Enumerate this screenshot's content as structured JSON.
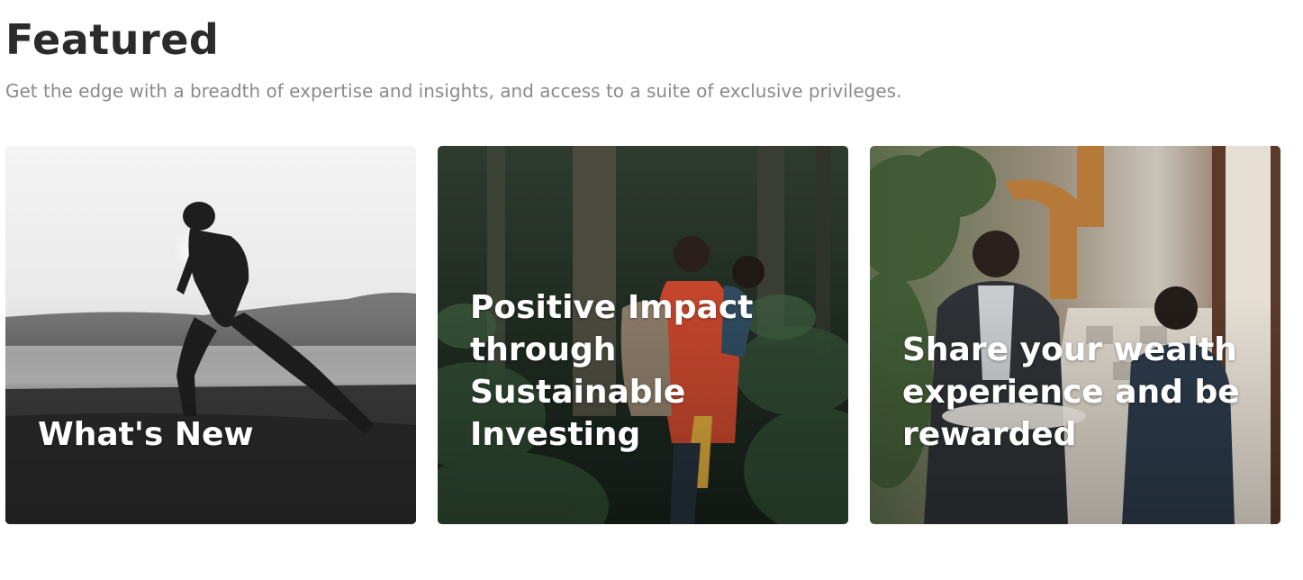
{
  "header": {
    "title": "Featured",
    "subtitle": "Get the edge with a breadth of expertise and insights, and access to a suite of exclusive privileges."
  },
  "cards": [
    {
      "title": "What's New",
      "image": "woman-stretching-on-beach-photo"
    },
    {
      "title": "Positive Impact through Sustainable Investing",
      "image": "father-carrying-child-in-forest-photo"
    },
    {
      "title": "Share your wealth experience and be rewarded",
      "image": "two-men-chatting-in-cafe-photo"
    }
  ],
  "colors": {
    "title": "#2b2b2b",
    "subtitle": "#8a8a8a",
    "card_text": "#ffffff"
  }
}
